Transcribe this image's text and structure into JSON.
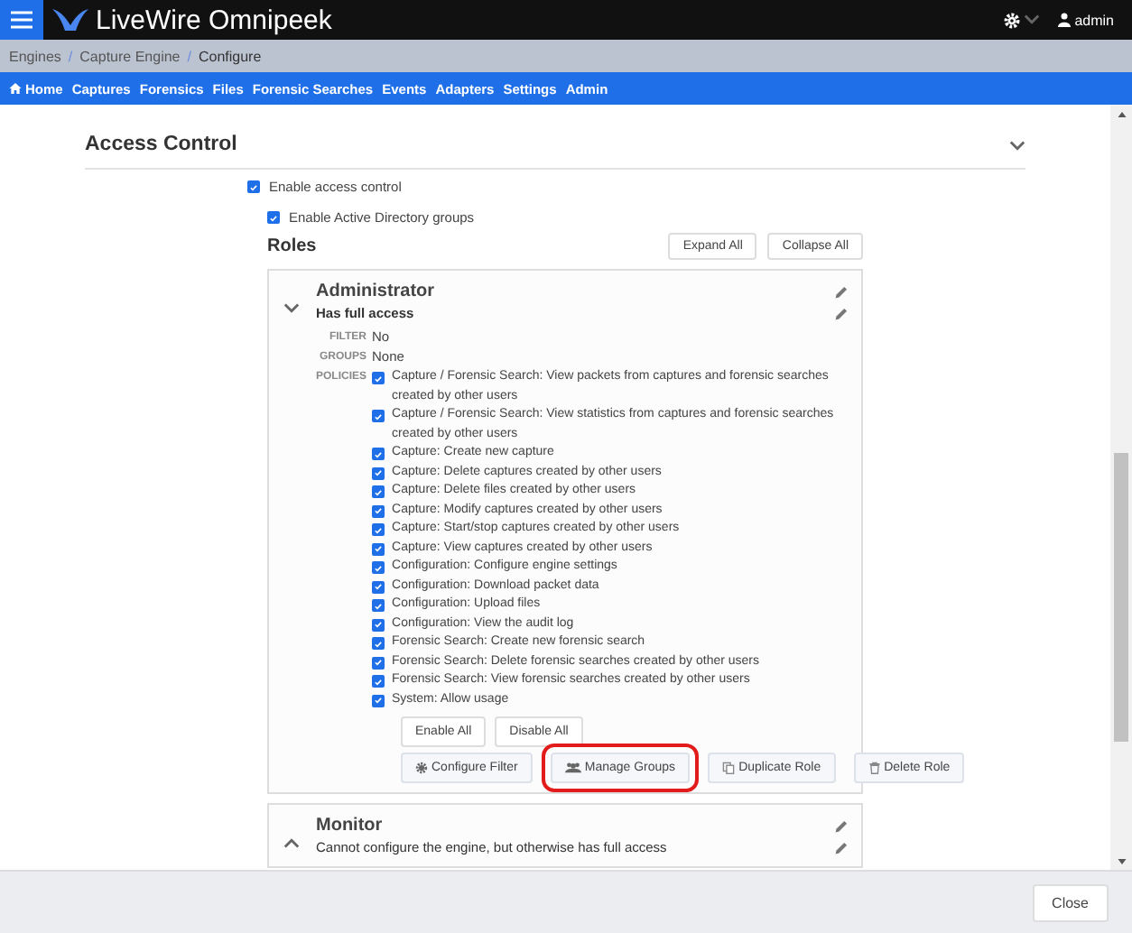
{
  "app": {
    "title": "LiveWire Omnipeek",
    "user": "admin"
  },
  "breadcrumb": [
    {
      "label": "Engines",
      "kind": "link"
    },
    {
      "label": "/",
      "kind": "separator"
    },
    {
      "label": "Capture Engine",
      "kind": "link"
    },
    {
      "label": "/",
      "kind": "separator"
    },
    {
      "label": "Configure",
      "kind": "current"
    }
  ],
  "nav": [
    {
      "label": "Home",
      "kind": "home"
    },
    {
      "label": "Captures",
      "kind": "link"
    },
    {
      "label": "Forensics",
      "kind": "link"
    },
    {
      "label": "Files",
      "kind": "link"
    },
    {
      "label": "Forensic Searches",
      "kind": "link"
    },
    {
      "label": "Events",
      "kind": "link"
    },
    {
      "label": "Adapters",
      "kind": "link"
    },
    {
      "label": "Settings",
      "kind": "link"
    },
    {
      "label": "Admin",
      "kind": "link"
    }
  ],
  "section": {
    "title": "Access Control",
    "expanded": true
  },
  "options": [
    {
      "label": "Enable access control",
      "checked": true
    },
    {
      "label": "Enable Active Directory groups",
      "checked": true
    }
  ],
  "roles_title": "Roles",
  "roles_buttons": [
    "Expand All",
    "Collapse All"
  ],
  "roles": [
    {
      "name": "Administrator",
      "description": "Has full access",
      "expanded": true,
      "fields": [
        {
          "label": "FILTER",
          "value": "No"
        },
        {
          "label": "GROUPS",
          "value": "None"
        }
      ],
      "policies_label": "POLICIES",
      "policies": [
        {
          "label": "Capture / Forensic Search: View packets from captures and forensic searches created by other users",
          "checked": true
        },
        {
          "label": "Capture / Forensic Search: View statistics from captures and forensic searches created by other users",
          "checked": true
        },
        {
          "label": "Capture: Create new capture",
          "checked": true
        },
        {
          "label": "Capture: Delete captures created by other users",
          "checked": true
        },
        {
          "label": "Capture: Delete files created by other users",
          "checked": true
        },
        {
          "label": "Capture: Modify captures created by other users",
          "checked": true
        },
        {
          "label": "Capture: Start/stop captures created by other users",
          "checked": true
        },
        {
          "label": "Capture: View captures created by other users",
          "checked": true
        },
        {
          "label": "Configuration: Configure engine settings",
          "checked": true
        },
        {
          "label": "Configuration: Download packet data",
          "checked": true
        },
        {
          "label": "Configuration: Upload files",
          "checked": true
        },
        {
          "label": "Configuration: View the audit log",
          "checked": true
        },
        {
          "label": "Forensic Search: Create new forensic search",
          "checked": true
        },
        {
          "label": "Forensic Search: Delete forensic searches created by other users",
          "checked": true
        },
        {
          "label": "Forensic Search: View forensic searches created by other users",
          "checked": true
        },
        {
          "label": "System: Allow usage",
          "checked": true
        }
      ],
      "policy_buttons": [
        "Enable All",
        "Disable All"
      ],
      "actions": [
        {
          "label": "Configure Filter",
          "kind": "filter",
          "highlighted": false
        },
        {
          "label": "Manage Groups",
          "kind": "groups",
          "highlighted": true
        },
        {
          "label": "Duplicate Role",
          "kind": "duplicate",
          "highlighted": false
        },
        {
          "label": "Delete Role",
          "kind": "delete",
          "highlighted": false
        }
      ]
    },
    {
      "name": "Monitor",
      "description": "Cannot configure the engine, but otherwise has full access",
      "expanded": false
    }
  ],
  "footer": {
    "button": "Close"
  }
}
